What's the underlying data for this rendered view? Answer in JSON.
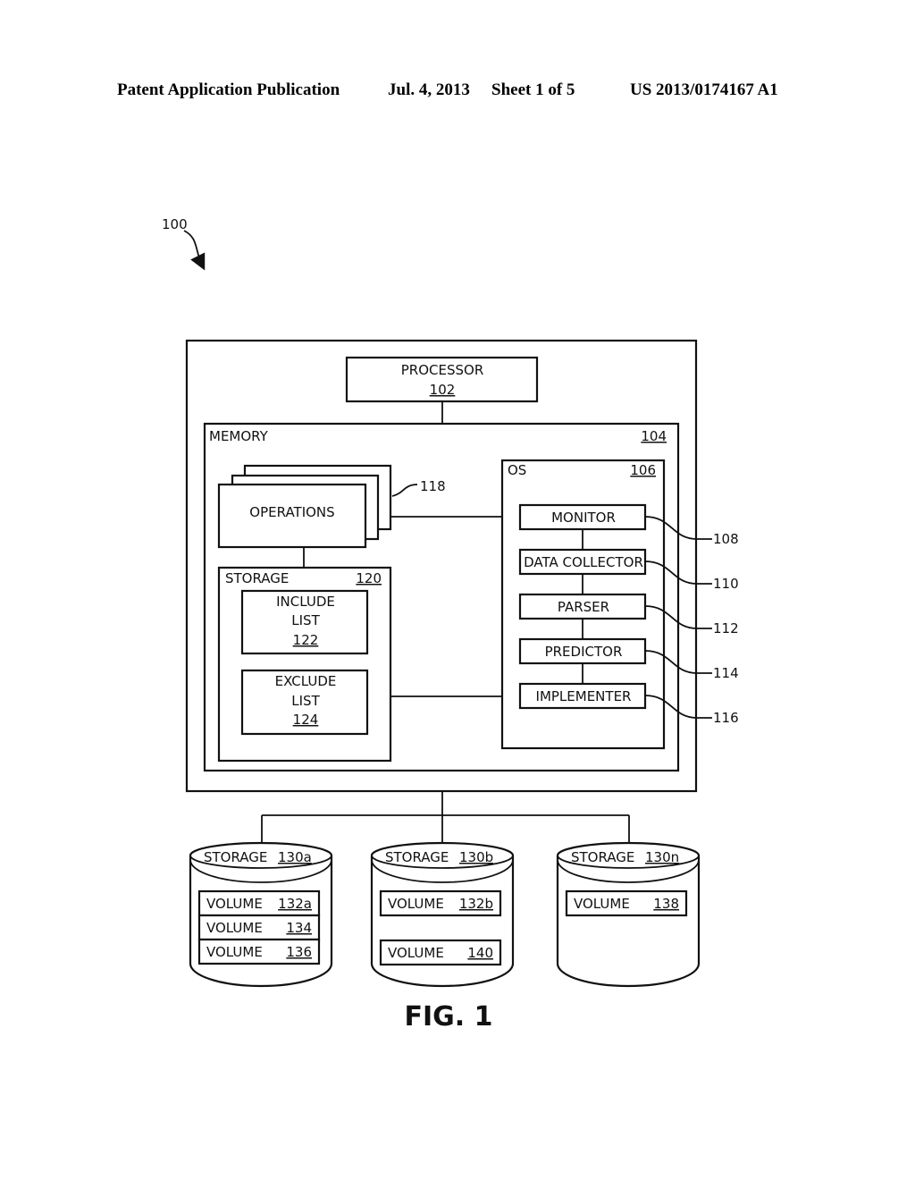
{
  "header": {
    "publication": "Patent Application Publication",
    "date": "Jul. 4, 2013",
    "sheet": "Sheet 1 of 5",
    "number": "US 2013/0174167 A1"
  },
  "figure": {
    "ref": "100",
    "caption": "FIG. 1",
    "processor": {
      "label": "PROCESSOR",
      "ref": "102"
    },
    "memory": {
      "label": "MEMORY",
      "ref": "104"
    },
    "os": {
      "label": "OS",
      "ref": "106"
    },
    "operations": {
      "label": "OPERATIONS",
      "ref": "118"
    },
    "storage": {
      "label": "STORAGE",
      "ref": "120"
    },
    "include_list": {
      "line1": "INCLUDE",
      "line2": "LIST",
      "ref": "122"
    },
    "exclude_list": {
      "line1": "EXCLUDE",
      "line2": "LIST",
      "ref": "124"
    },
    "os_modules": [
      {
        "label": "MONITOR",
        "ref": "108"
      },
      {
        "label": "DATA COLLECTOR",
        "ref": "110"
      },
      {
        "label": "PARSER",
        "ref": "112"
      },
      {
        "label": "PREDICTOR",
        "ref": "114"
      },
      {
        "label": "IMPLEMENTER",
        "ref": "116"
      }
    ],
    "storage_devices": [
      {
        "label": "STORAGE",
        "ref": "130a",
        "volumes": [
          {
            "label": "VOLUME",
            "ref": "132a"
          },
          {
            "label": "VOLUME",
            "ref": "134"
          },
          {
            "label": "VOLUME",
            "ref": "136"
          }
        ]
      },
      {
        "label": "STORAGE",
        "ref": "130b",
        "volumes": [
          {
            "label": "VOLUME",
            "ref": "132b"
          },
          {
            "label": "VOLUME",
            "ref": "140"
          }
        ]
      },
      {
        "label": "STORAGE",
        "ref": "130n",
        "volumes": [
          {
            "label": "VOLUME",
            "ref": "138"
          }
        ]
      }
    ]
  }
}
